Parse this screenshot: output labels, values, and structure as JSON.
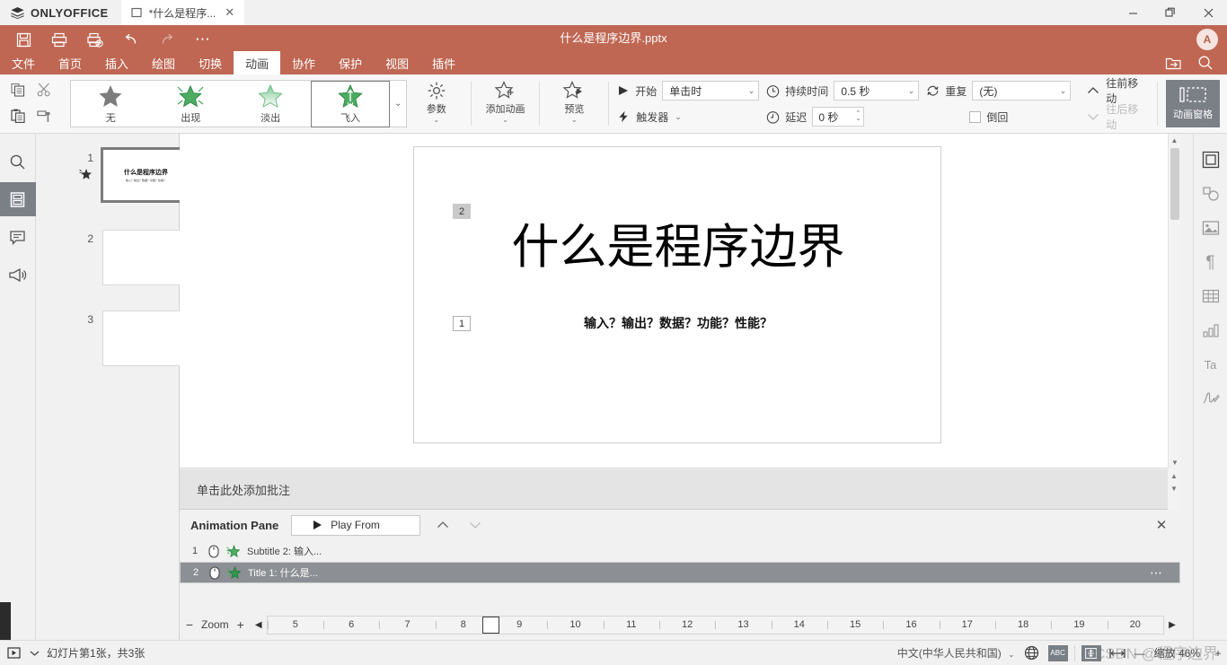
{
  "app": {
    "brand": "ONLYOFFICE",
    "document_title": "什么是程序边界.pptx",
    "tab_label": "*什么是程序...",
    "avatar_initial": "A"
  },
  "window_controls": {
    "minimize": "—",
    "maximize": "❐",
    "close": "✕"
  },
  "quick_access": [
    {
      "name": "save-button",
      "icon": "save-icon"
    },
    {
      "name": "print-button",
      "icon": "print-icon"
    },
    {
      "name": "quick-print-button",
      "icon": "quick-print-icon"
    },
    {
      "name": "undo-button",
      "icon": "undo-icon"
    },
    {
      "name": "redo-button",
      "icon": "redo-icon",
      "disabled": true
    },
    {
      "name": "customize-quick-access-button",
      "icon": "more-dots-icon",
      "glyph": "⋯"
    }
  ],
  "ribbon_tabs": [
    {
      "label": "文件",
      "active": false
    },
    {
      "label": "首页",
      "active": false
    },
    {
      "label": "插入",
      "active": false
    },
    {
      "label": "绘图",
      "active": false
    },
    {
      "label": "切换",
      "active": false
    },
    {
      "label": "动画",
      "active": true
    },
    {
      "label": "协作",
      "active": false
    },
    {
      "label": "保护",
      "active": false
    },
    {
      "label": "视图",
      "active": false
    },
    {
      "label": "插件",
      "active": false
    }
  ],
  "header_right": [
    {
      "name": "open-file-location-icon"
    },
    {
      "name": "search-icon"
    }
  ],
  "clipboard": [
    {
      "name": "copy-icon"
    },
    {
      "name": "cut-icon"
    },
    {
      "name": "paste-icon"
    },
    {
      "name": "format-painter-icon"
    }
  ],
  "animation_gallery": {
    "items": [
      {
        "label": "无",
        "style": "none",
        "selected": false
      },
      {
        "label": "出现",
        "style": "appear",
        "selected": false
      },
      {
        "label": "淡出",
        "style": "fade",
        "selected": false
      },
      {
        "label": "飞入",
        "style": "flyin",
        "selected": true
      }
    ],
    "more_label": "⌄"
  },
  "toolbar": {
    "parameters_label": "参数",
    "add_animation_label": "添加动画",
    "preview_label": "预览",
    "start_label": "开始",
    "start_value": "单击时",
    "trigger_label": "触发器",
    "duration_label": "持续时间",
    "duration_value": "0.5 秒",
    "delay_label": "延迟",
    "delay_value": "0 秒",
    "repeat_label": "重复",
    "repeat_value": "(无)",
    "rewind_label": "倒回",
    "move_earlier_label": "往前移动",
    "move_later_label": "往后移动",
    "animation_pane_label": "动画窗格"
  },
  "left_rail": [
    {
      "name": "sidebar-search-icon",
      "active": false
    },
    {
      "name": "sidebar-slides-icon",
      "active": true
    },
    {
      "name": "sidebar-comments-icon",
      "active": false
    },
    {
      "name": "sidebar-feedback-icon",
      "active": false
    }
  ],
  "right_rail": [
    {
      "name": "slide-settings-icon",
      "active": true
    },
    {
      "name": "shape-settings-icon",
      "active": false
    },
    {
      "name": "image-settings-icon",
      "active": false
    },
    {
      "name": "paragraph-settings-icon",
      "active": false,
      "glyph": "¶"
    },
    {
      "name": "table-settings-icon",
      "active": false
    },
    {
      "name": "chart-settings-icon",
      "active": false
    },
    {
      "name": "text-art-settings-icon",
      "active": false,
      "glyph": "Ta"
    },
    {
      "name": "signature-settings-icon",
      "active": false
    }
  ],
  "thumbnails": [
    {
      "number": "1",
      "selected": true,
      "has_animation": true,
      "title": "什么是程序边界",
      "subtitle": "输入？输出？数据？功能？性能？"
    },
    {
      "number": "2",
      "selected": false,
      "has_animation": false,
      "title": "",
      "subtitle": ""
    },
    {
      "number": "3",
      "selected": false,
      "has_animation": false,
      "title": "",
      "subtitle": ""
    }
  ],
  "slide": {
    "title": "什么是程序边界",
    "subtitle": "输入？输出？数据？功能？性能？",
    "animation_tags": [
      {
        "label": "2",
        "style": "filled"
      },
      {
        "label": "1",
        "style": "hollow"
      }
    ]
  },
  "notes": {
    "placeholder": "单击此处添加批注"
  },
  "animation_pane": {
    "title": "Animation Pane",
    "play_from_label": "Play From",
    "move_up_label": "▲",
    "move_down_label": "▼",
    "close_label": "✕",
    "rows": [
      {
        "index": "1",
        "name": "Subtitle 2: 输入...",
        "selected": false
      },
      {
        "index": "2",
        "name": "Title 1: 什么是...",
        "selected": true,
        "menu": "⋯"
      }
    ],
    "zoom_label": "Zoom",
    "zoom_minus": "−",
    "zoom_plus": "+",
    "scroll_left": "◀",
    "scroll_right": "▶",
    "ruler_ticks": [
      "5",
      "6",
      "7",
      "8",
      "9",
      "10",
      "11",
      "12",
      "13",
      "14",
      "15",
      "16",
      "17",
      "18",
      "19",
      "20"
    ],
    "cursor_after_tick": "8"
  },
  "status_bar": {
    "start_slideshow_name": "start-slideshow-icon",
    "slide_count_text": "幻灯片第1张，共3张",
    "language": "中文(中华人民共和国)",
    "set_language_icon": "globe-icon",
    "spellcheck_icon": "spellcheck-icon",
    "fit_slide_icon": "fit-slide-icon",
    "fit_width_icon": "fit-width-icon",
    "zoom_out": "—",
    "zoom_text": "缩放 46%",
    "zoom_in": "+"
  },
  "watermark": {
    "text": "CSDN @程序边界"
  },
  "colors": {
    "accent": "#bf6753",
    "panel": "#f1f1f1",
    "selected_row": "#8c8f94",
    "animation_green": "#3faa57"
  }
}
